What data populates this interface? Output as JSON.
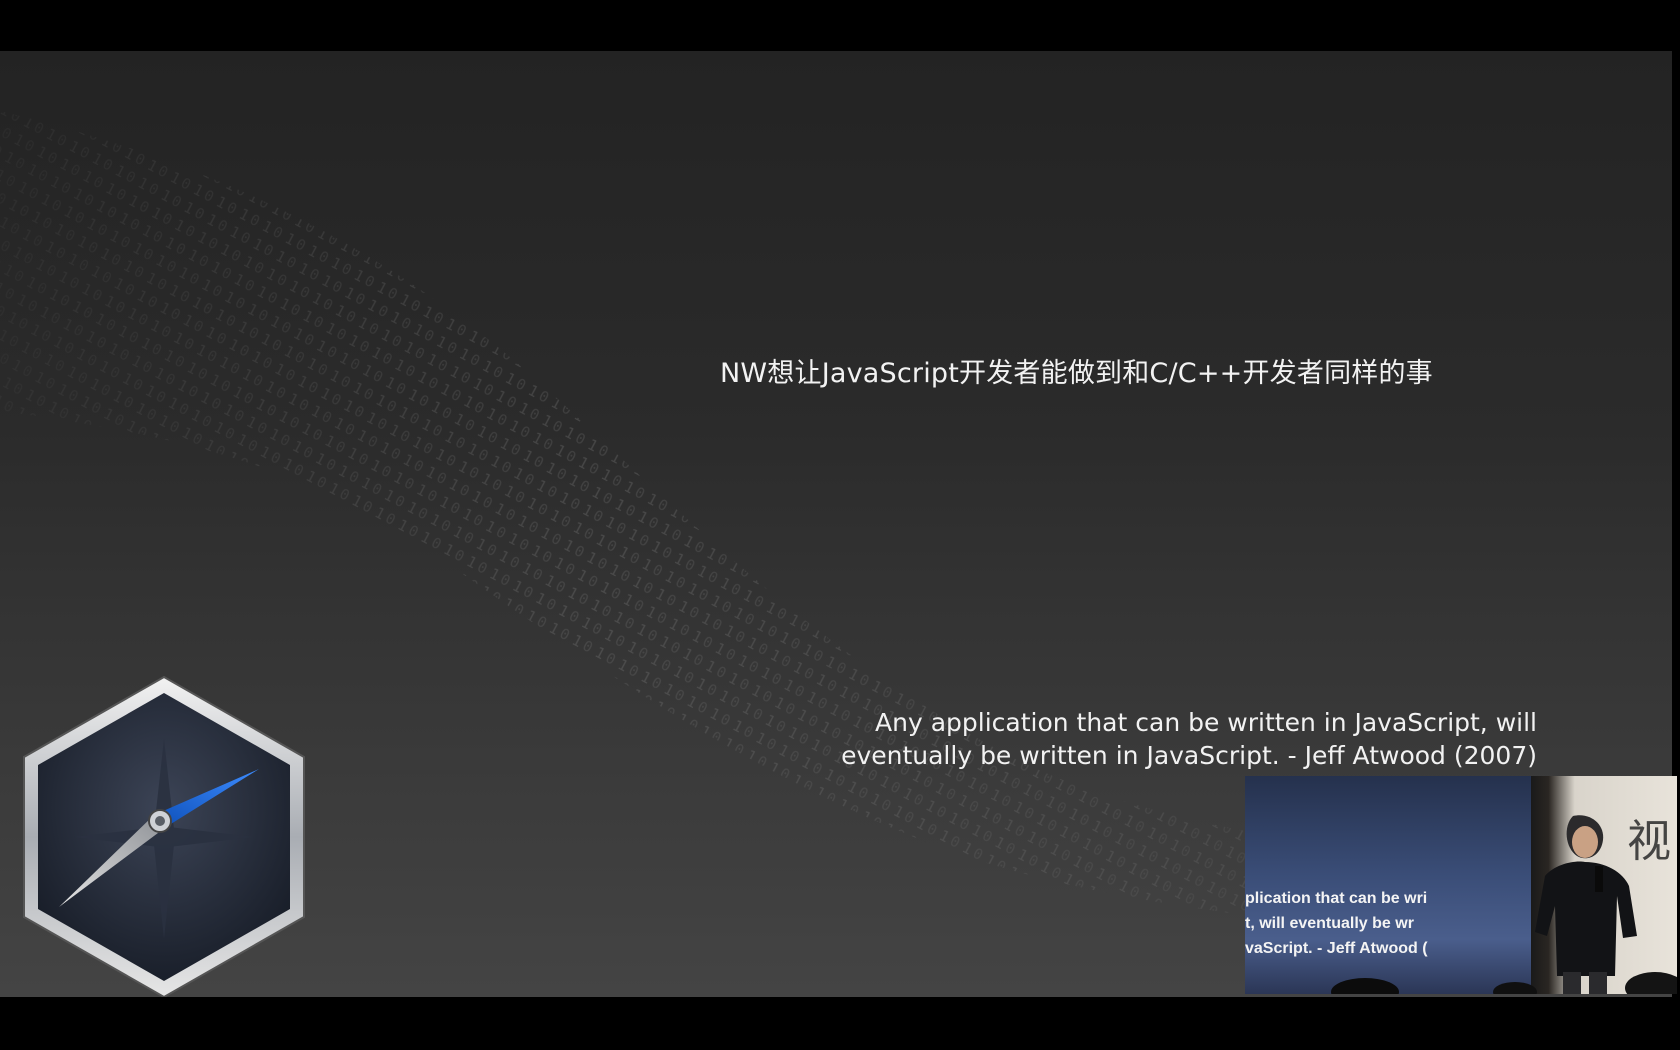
{
  "slide": {
    "headline": "NW想让JavaScript开发者能做到和C/C++开发者同样的事",
    "quote_lines": [
      "Any application that can be written in JavaScript, will",
      "eventually be written in JavaScript. - Jeff Atwood (2007)"
    ],
    "logo_icon": "compass-icon",
    "colors": {
      "accent_blue": "#1e6fe0",
      "text": "#f2f2f2"
    }
  },
  "camera_overlay": {
    "lines": [
      "plication that can be wri",
      "t, will eventually be wr",
      "vaScript. - Jeff Atwood ("
    ],
    "speaker_icon": "speaker-figure"
  }
}
